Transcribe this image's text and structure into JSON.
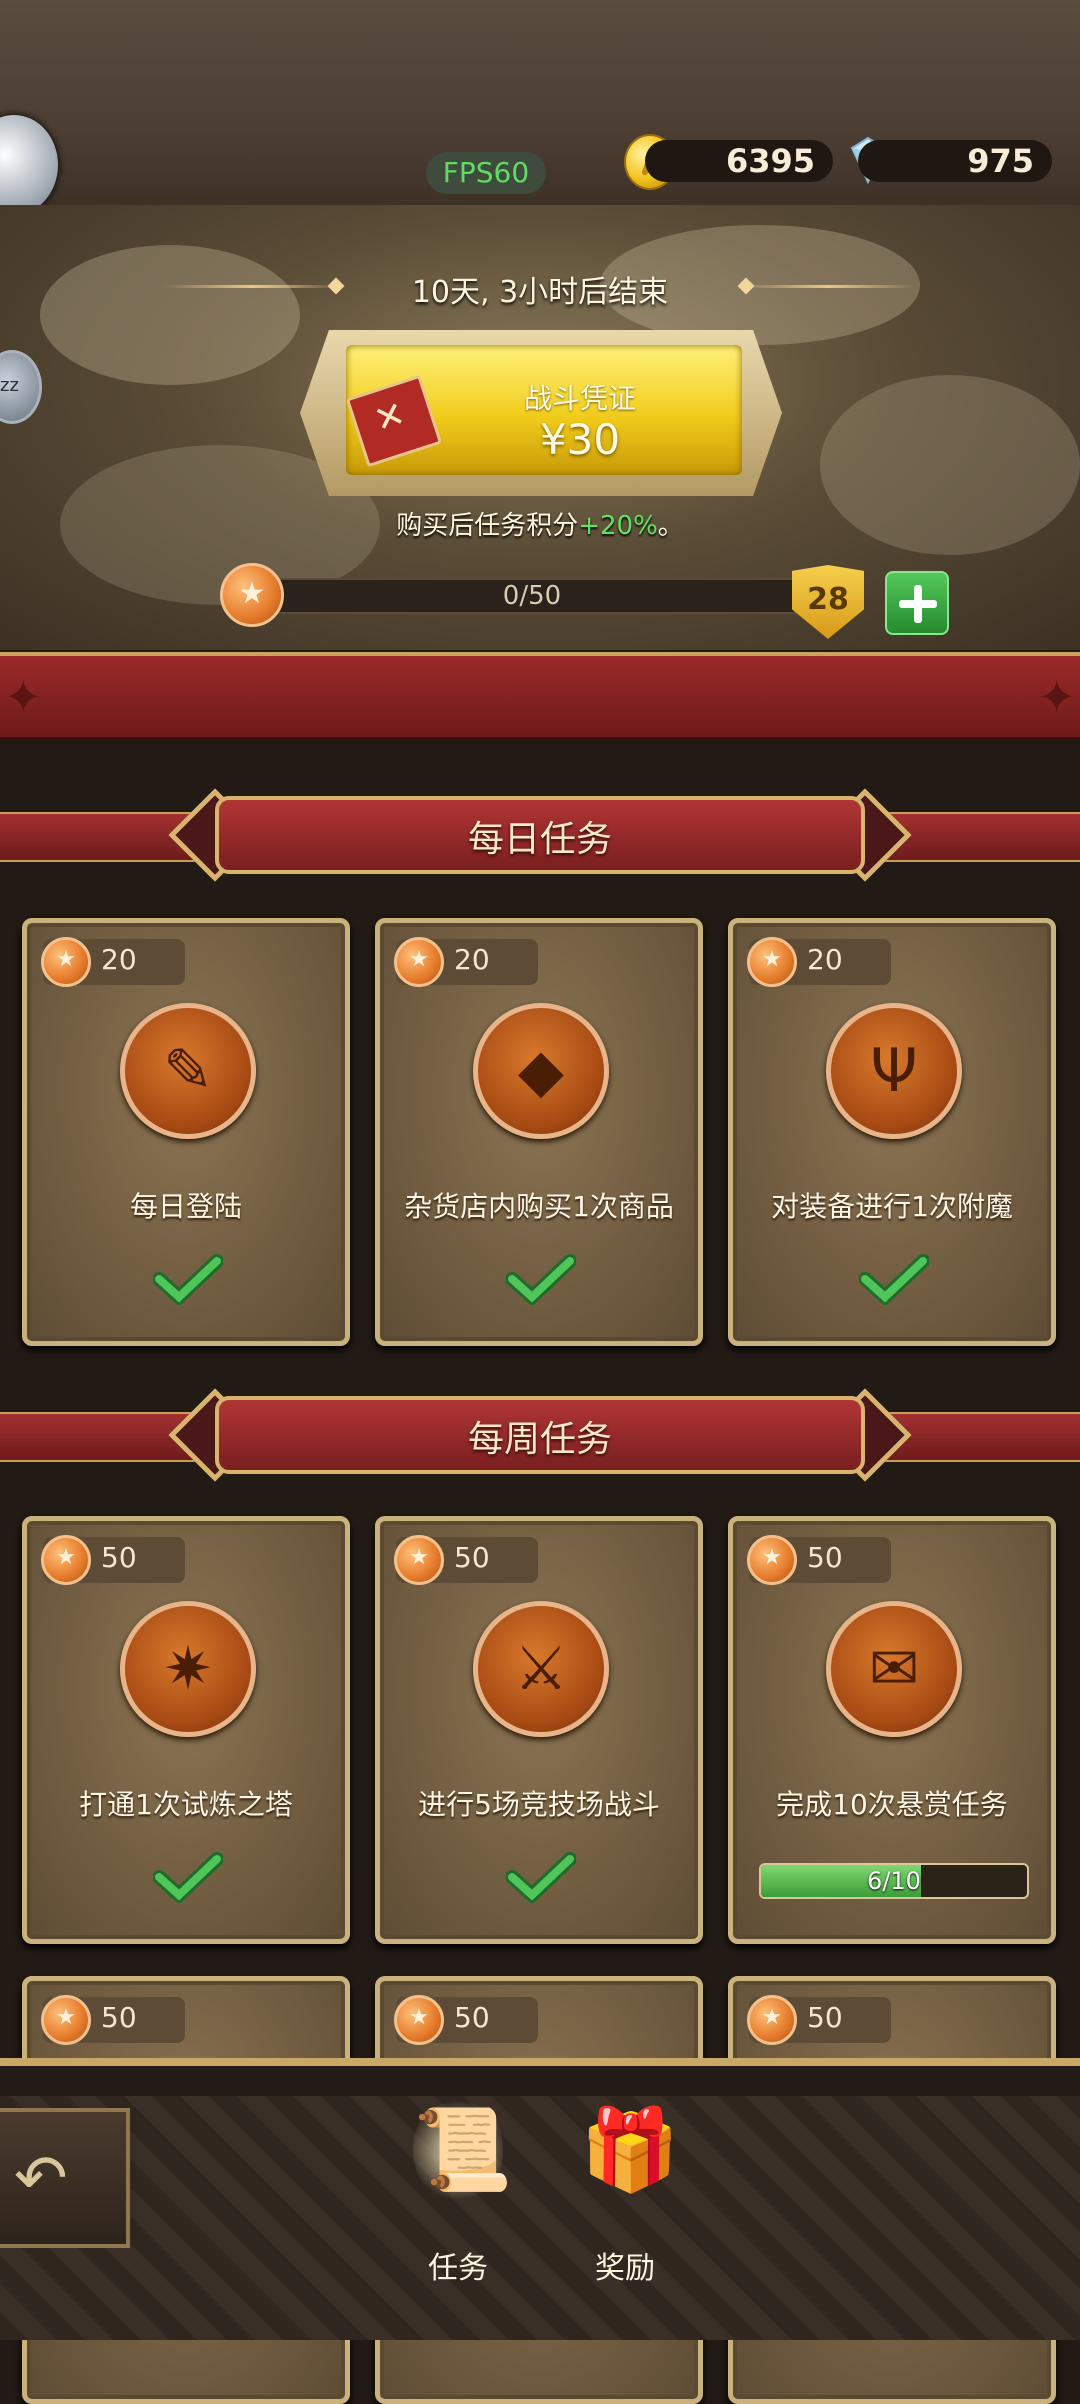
{
  "header": {
    "fps": "FPS60",
    "gold": "6395",
    "gems": "975",
    "side_button_text": "zz"
  },
  "banner": {
    "ends_text": "10天, 3小时后结束",
    "pass_title": "战斗凭证",
    "pass_price": "¥30",
    "bonus_prefix": "购买后任务积分",
    "bonus_value": "+20%",
    "bonus_suffix": "。",
    "progress_text": "0/50",
    "progress_fraction": 0,
    "level": "28"
  },
  "sections": {
    "daily_title": "每日任务",
    "weekly_title": "每周任务"
  },
  "daily_tasks": [
    {
      "points": "20",
      "label": "每日登陆",
      "icon": "notebook-icon",
      "done": true
    },
    {
      "points": "20",
      "label": "杂货店内购买1次商品",
      "icon": "gem-bag-icon",
      "done": true
    },
    {
      "points": "20",
      "label": "对装备进行1次附魔",
      "icon": "enchant-rune-icon",
      "done": true
    }
  ],
  "weekly_tasks": [
    {
      "points": "50",
      "label": "打通1次试炼之塔",
      "icon": "tower-emblem-icon",
      "done": true
    },
    {
      "points": "50",
      "label": "进行5场竞技场战斗",
      "icon": "crossed-swords-icon",
      "done": true
    },
    {
      "points": "50",
      "label": "完成10次悬赏任务",
      "icon": "scroll-icon",
      "done": false,
      "progress_text": "6/10",
      "progress": 0.6
    }
  ],
  "next_row_points": [
    "50",
    "50",
    "50"
  ],
  "nav": {
    "tasks_label": "任务",
    "rewards_label": "奖励"
  },
  "colors": {
    "accent_gold": "#c9b27c",
    "banner_red": "#9c2a2a",
    "success_green": "#3c9c3a"
  }
}
